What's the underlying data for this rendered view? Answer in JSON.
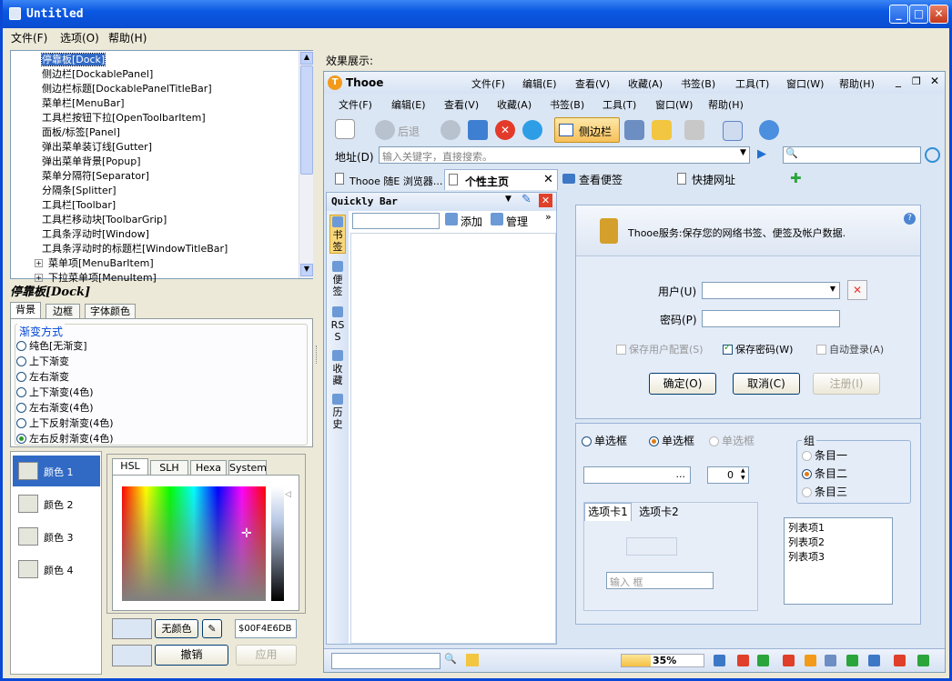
{
  "app": {
    "title": "Untitled"
  },
  "menu": [
    "文件(F)",
    "选项(O)",
    "帮助(H)"
  ],
  "tree": {
    "items": [
      "停靠板[Dock]",
      "侧边栏[DockablePanel]",
      "侧边栏标题[DockablePanelTitleBar]",
      "菜单栏[MenuBar]",
      "工具栏按钮下拉[OpenToolbarItem]",
      "面板/标签[Panel]",
      "弹出菜单装订线[Gutter]",
      "弹出菜单背景[Popup]",
      "菜单分隔符[Separator]",
      "分隔条[Splitter]",
      "工具栏[Toolbar]",
      "工具栏移动块[ToolbarGrip]",
      "工具条浮动时[Window]",
      "工具条浮动时的标题栏[WindowTitleBar]",
      "菜单项[MenuBarItem]",
      "下拉菜单项[MenuItem]"
    ],
    "selected_index": 0
  },
  "props": {
    "heading": "停靠板[Dock]",
    "tabs": [
      "背景",
      "边框",
      "字体颜色"
    ],
    "group_title": "渐变方式",
    "options": [
      "纯色[无渐变]",
      "上下渐变",
      "左右渐变",
      "上下渐变(4色)",
      "左右渐变(4色)",
      "上下反射渐变(4色)",
      "左右反射渐变(4色)"
    ],
    "selected_option": 6,
    "colors": [
      "颜色 1",
      "颜色 2",
      "颜色 3",
      "颜色 4"
    ],
    "picker_tabs": [
      "HSL",
      "SLH",
      "Hexa",
      "System"
    ],
    "no_color": "无颜色",
    "hex_value": "$00F4E6DB",
    "undo": "撤销",
    "apply": "应用"
  },
  "preview": {
    "label": "效果展示:",
    "brand": "Thooe",
    "top_menu": [
      "文件(F)",
      "编辑(E)",
      "查看(V)",
      "收藏(A)",
      "书签(B)",
      "工具(T)",
      "窗口(W)",
      "帮助(H)"
    ],
    "menu2": [
      "文件(F)",
      "编辑(E)",
      "查看(V)",
      "收藏(A)",
      "书签(B)",
      "工具(T)",
      "窗口(W)",
      "帮助(H)"
    ],
    "back_label": "后退",
    "sidebar_btn": "侧边栏",
    "address_label": "地址(D)",
    "address_placeholder": "输入关键字，直接搜索。",
    "tabs": [
      "Thooe 随E 浏览器...",
      "个性主页",
      "查看便签",
      "快捷网址"
    ],
    "quickbar_title": "Quickly Bar",
    "quick_add": "添加",
    "quick_manage": "管理",
    "side_tabs": [
      "书签",
      "便签",
      "RSS",
      "收藏",
      "历史"
    ],
    "login_title": "Thooe服务:保存您的网络书签、便签及帐户数据.",
    "user_label": "用户(U)",
    "pwd_label": "密码(P)",
    "chk_save_cfg": "保存用户配置(S)",
    "chk_save_pwd": "保存密码(W)",
    "chk_auto": "自动登录(A)",
    "ok": "确定(O)",
    "cancel": "取消(C)",
    "register": "注册(I)",
    "radio_row": [
      "单选框",
      "单选框",
      "单选框"
    ],
    "spin_value": "0",
    "group": {
      "title": "组",
      "items": [
        "条目一",
        "条目二",
        "条目三"
      ]
    },
    "cardtabs": [
      "选项卡1",
      "选项卡2"
    ],
    "input_placeholder": "输入 框",
    "list": [
      "列表项1",
      "列表项2",
      "列表项3"
    ],
    "progress": "35%",
    "progress_value": 35
  },
  "colors": {
    "title_blue": "#0b58e2",
    "panel_bg": "#ece9d8",
    "preview_bg": "#dbe6f4"
  }
}
